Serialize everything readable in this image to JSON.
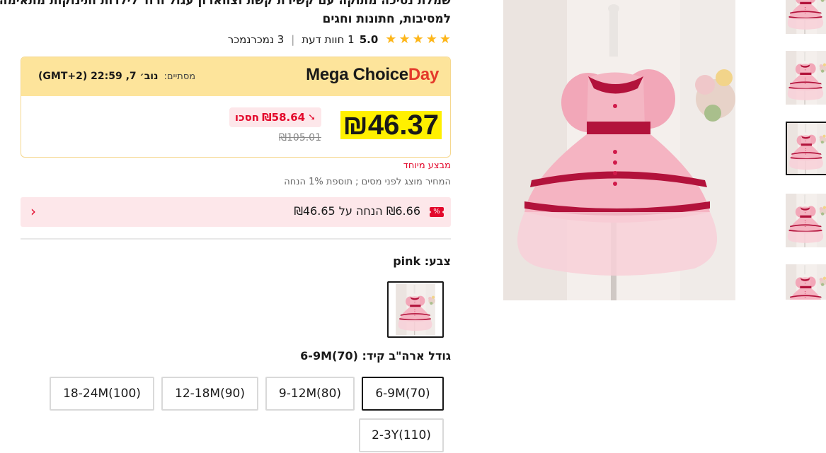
{
  "product": {
    "title": "שמלת נסיכה מתוקה עם קשירת קשת וצווארון עגול ורוד לילדות ותינוקות מתאימה למסיבות, חתונות וחגים",
    "rating": "5.0",
    "reviews_count": "1",
    "reviews_label": "חוות דעת",
    "sold_count": "3",
    "sold_label": "נמכרנמכר",
    "star_count": 5
  },
  "promo": {
    "brand_part1": "Mega Choice",
    "brand_part2": "Day",
    "ends_label": "מסתיים:",
    "ends_value": "נוב׳ 7, 22:59 (GMT+2)"
  },
  "price": {
    "current": "₪46.37",
    "save_amount": "₪58.64",
    "save_label": "חסכו",
    "original": "₪105.01",
    "special_offer": "מבצע מיוחד",
    "tax_note": "המחיר מוצג לפני מסים ; תוספת 1% הנחה"
  },
  "coupon": {
    "icon_text": "%",
    "text": "₪6.66 הנחה על ₪46.65"
  },
  "color": {
    "label": "צבע:",
    "value": "pink"
  },
  "size": {
    "label": "גודל ארה\"ב קיד:",
    "value": "6-9M(70)",
    "options": [
      "6-9M(70)",
      "9-12M(80)",
      "12-18M(90)",
      "18-24M(100)",
      "2-3Y(110)"
    ],
    "selected": "6-9M(70)"
  },
  "colors": {
    "accent_red": "#e3082b",
    "promo_yellow": "#fde49b",
    "price_highlight": "#fff000",
    "star": "#fdb61a"
  }
}
